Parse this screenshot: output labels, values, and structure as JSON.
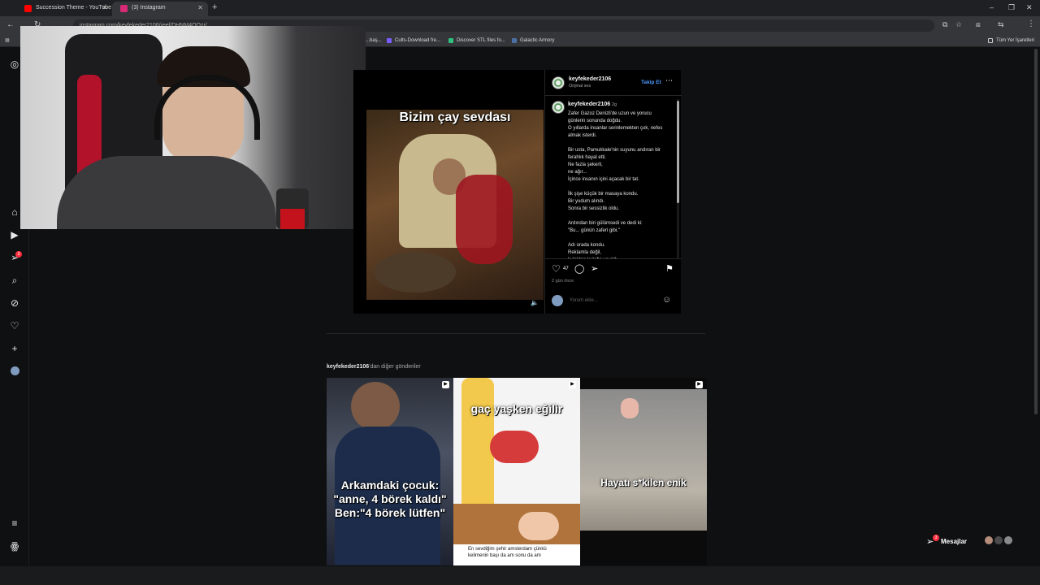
{
  "browser": {
    "tabs": [
      {
        "title": "Succession Theme - YouTube",
        "color": "#ff0000"
      },
      {
        "title": "(3) Instagram",
        "color": "#d62976"
      }
    ],
    "url": "instagram.com/keyfekeder2106/reel/DHNM4OQzr/",
    "bookmarks": [
      "...baş...",
      "Cults-Download fre...",
      "Discover STL files fo...",
      "Galactic Armory"
    ],
    "all_bookmarks": "Tüm Yer İşaretleri"
  },
  "nav": {
    "notification_count": "3",
    "icons": [
      "instagram-icon",
      "home-icon",
      "reels-icon",
      "messages-icon",
      "search-icon",
      "explore-icon",
      "heart-icon",
      "create-icon",
      "profile-avatar",
      "menu-icon",
      "threads-icon"
    ]
  },
  "post": {
    "media_caption": "Bizim çay sevdası",
    "username": "keyfekeder2106",
    "audio": "Orijinal ses",
    "follow_label": "Takip Et",
    "caption_user": "keyfekeder2106",
    "caption_age": "2g",
    "caption_text": "Zafer Gazoz Denizli'de uzun ve yorucu günlerin sonunda doğdu.\nO yıllarda insanlar serinlemekten çok, nefes almak isterdi.\n\nBir usta, Pamukkale'nin suyunu andıran bir ferahlık hayal etti.\nNe fazla şekerli,\nne ağır...\nİçince insanın içini açacak bir tat.\n\nİlk şişe küçük bir masaya kondu.\nBir yudum alındı.\nSonra bir sessizlik oldu.\n\nArdından biri gülümsedi ve dedi ki:\n\"Bu... günün zaferi gibi.\"\n\nAdı orada kondu.\nReklamla değil,\nkulaktan kulağa yayıldı.",
    "likes": "47",
    "time_ago": "2 gün önce",
    "comment_placeholder": "Yorum ekle..."
  },
  "more_posts": {
    "user": "keyfekeder2106",
    "suffix": "'dan diğer gönderiler",
    "items": [
      {
        "text": "Arkamdaki çocuk:\n\"anne, 4 börek kaldı\"\nBen:\"4 börek lütfen\""
      },
      {
        "text": "gaç yaşken eğilir",
        "subtext": "En sevdiğim şehir amsterdam çünkü\nkelimenin başı da am sonu da am"
      },
      {
        "text": "Hayatı s*kilen enik"
      }
    ]
  },
  "messages": {
    "label": "Mesajlar",
    "count": "3"
  }
}
